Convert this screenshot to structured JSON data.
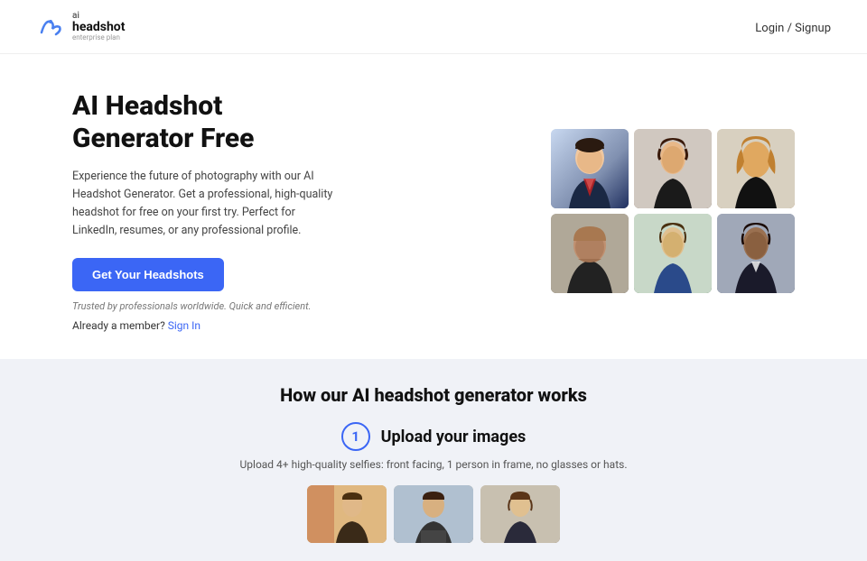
{
  "header": {
    "logo_ai": "ai",
    "logo_headshot": "headshot",
    "logo_tagline": "enterprise plan",
    "nav_login": "Login / Signup"
  },
  "hero": {
    "title": "AI Headshot Generator Free",
    "description": "Experience the future of photography with our AI Headshot Generator. Get a professional, high-quality headshot for free on your first try. Perfect for LinkedIn, resumes, or any professional profile.",
    "cta_label": "Get Your Headshots",
    "trusted_text": "Trusted by professionals worldwide. Quick and efficient.",
    "sign_in_prompt": "Already a member?",
    "sign_in_link": "Sign In"
  },
  "how_section": {
    "title": "How our AI headshot generator works",
    "step_number": "1",
    "step_label": "Upload your images",
    "step_desc": "Upload 4+ high-quality selfies: front facing, 1 person in frame, no glasses or hats."
  }
}
